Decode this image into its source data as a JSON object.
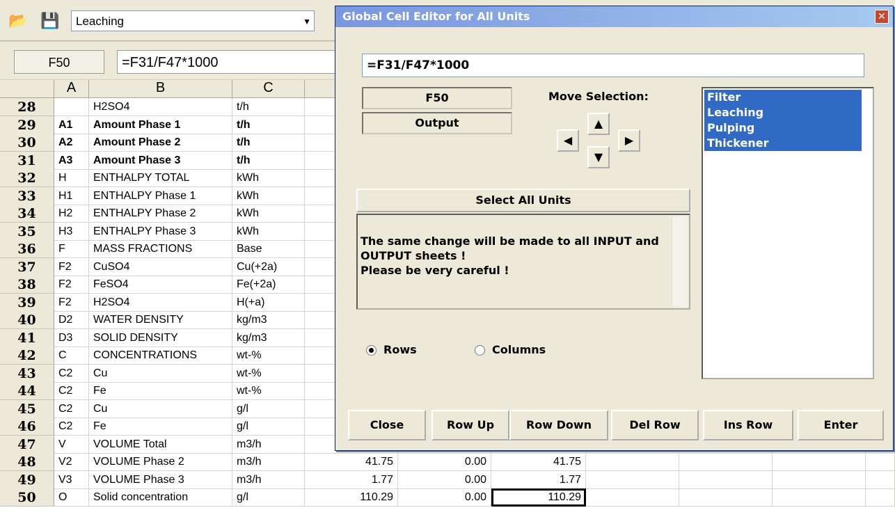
{
  "toolbar": {
    "unit_selected": "Leaching",
    "open_icon": "folder-open-icon",
    "save_icon": "save-icon"
  },
  "formula_bar": {
    "cell_ref": "F50",
    "formula": "=F31/F47*1000"
  },
  "grid": {
    "columns": [
      "A",
      "B",
      "C"
    ],
    "rows": [
      {
        "n": "28",
        "a": "",
        "b": "H2SO4",
        "c": "t/h",
        "bold": false
      },
      {
        "n": "29",
        "a": "A1",
        "b": "Amount Phase 1",
        "c": "t/h",
        "bold": true
      },
      {
        "n": "30",
        "a": "A2",
        "b": "Amount Phase 2",
        "c": "t/h",
        "bold": true
      },
      {
        "n": "31",
        "a": "A3",
        "b": "Amount Phase 3",
        "c": "t/h",
        "bold": true
      },
      {
        "n": "32",
        "a": "H",
        "b": "ENTHALPY TOTAL",
        "c": "kWh",
        "bold": false
      },
      {
        "n": "33",
        "a": "H1",
        "b": "ENTHALPY Phase 1",
        "c": "kWh",
        "bold": false
      },
      {
        "n": "34",
        "a": "H2",
        "b": "ENTHALPY Phase 2",
        "c": "kWh",
        "bold": false
      },
      {
        "n": "35",
        "a": "H3",
        "b": "ENTHALPY Phase 3",
        "c": "kWh",
        "bold": false
      },
      {
        "n": "36",
        "a": "F",
        "b": "MASS FRACTIONS",
        "c": "Base",
        "bold": false
      },
      {
        "n": "37",
        "a": "F2",
        "b": "CuSO4",
        "c": "Cu(+2a)",
        "bold": false
      },
      {
        "n": "38",
        "a": "F2",
        "b": "FeSO4",
        "c": "Fe(+2a)",
        "bold": false
      },
      {
        "n": "39",
        "a": "F2",
        "b": "H2SO4",
        "c": "H(+a)",
        "bold": false
      },
      {
        "n": "40",
        "a": "D2",
        "b": "WATER DENSITY",
        "c": "kg/m3",
        "bold": false
      },
      {
        "n": "41",
        "a": "D3",
        "b": "SOLID DENSITY",
        "c": "kg/m3",
        "bold": false
      },
      {
        "n": "42",
        "a": "C",
        "b": "CONCENTRATIONS",
        "c": "wt-%",
        "bold": false
      },
      {
        "n": "43",
        "a": "C2",
        "b": "Cu",
        "c": "wt-%",
        "bold": false
      },
      {
        "n": "44",
        "a": "C2",
        "b": "Fe",
        "c": "wt-%",
        "bold": false
      },
      {
        "n": "45",
        "a": "C2",
        "b": "Cu",
        "c": "g/l",
        "bold": false
      },
      {
        "n": "46",
        "a": "C2",
        "b": "Fe",
        "c": "g/l",
        "bold": false
      },
      {
        "n": "47",
        "a": "V",
        "b": "VOLUME Total",
        "c": "m3/h",
        "bold": false
      },
      {
        "n": "48",
        "a": "V2",
        "b": "VOLUME Phase 2",
        "c": "m3/h",
        "bold": false
      },
      {
        "n": "49",
        "a": "V3",
        "b": "VOLUME Phase 3",
        "c": "m3/h",
        "bold": false
      },
      {
        "n": "50",
        "a": "O",
        "b": "Solid concentration",
        "c": "g/l",
        "bold": false
      }
    ],
    "value_rows": [
      {
        "row": "48",
        "d": "41.75",
        "e": "0.00",
        "f": "41.75"
      },
      {
        "row": "49",
        "d": "1.77",
        "e": "0.00",
        "f": "1.77"
      },
      {
        "row": "50",
        "d": "110.29",
        "e": "0.00",
        "f": "110.29"
      }
    ]
  },
  "dialog": {
    "title": "Global Cell Editor for All Units",
    "formula": "=F31/F47*1000",
    "cell_ref": "F50",
    "sheet_type": "Output",
    "move_selection_label": "Move Selection:",
    "units": [
      "Filter",
      "Leaching",
      "Pulping",
      "Thickener"
    ],
    "select_all_label": "Select All Units",
    "message": "The same change will be made to all INPUT and OUTPUT sheets !\nPlease be very careful !",
    "radio_rows": "Rows",
    "radio_columns": "Columns",
    "buttons": [
      "Close",
      "Row Up",
      "Row Down",
      "Del Row",
      "Ins Row",
      "Enter"
    ]
  }
}
